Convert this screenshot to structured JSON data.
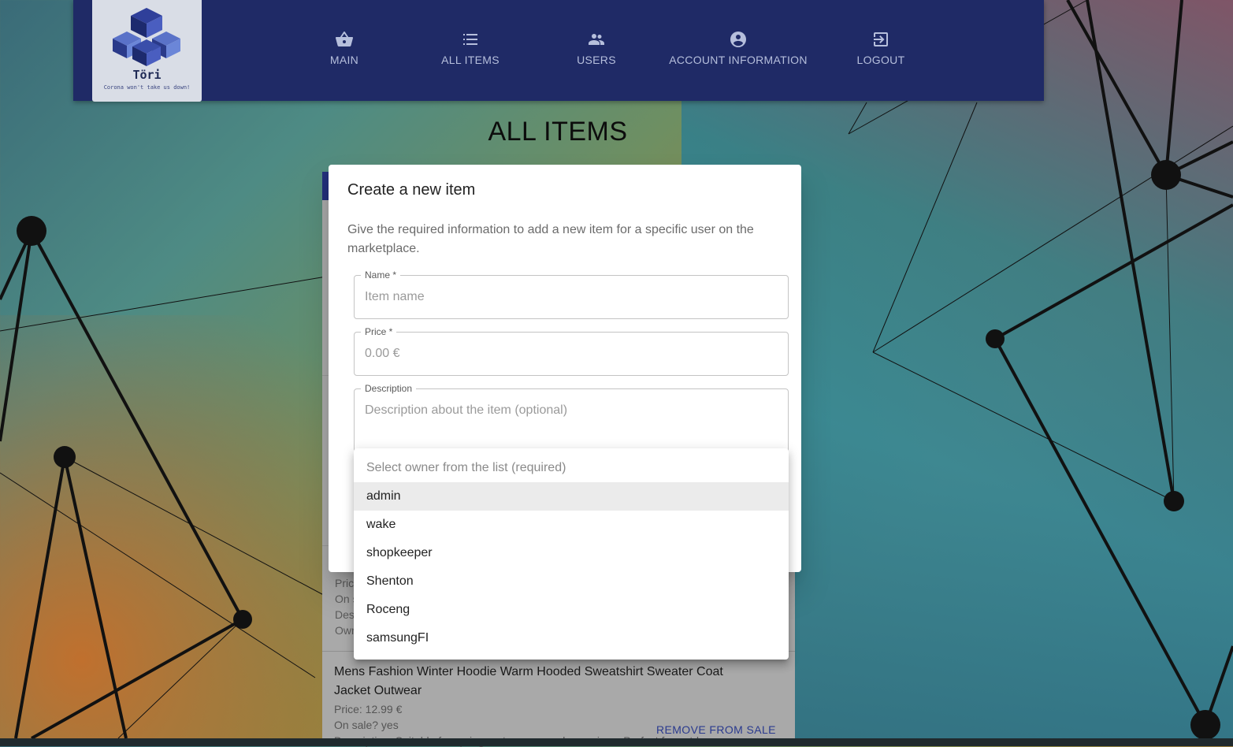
{
  "nav": {
    "logo_title": "Töri",
    "logo_tagline": "Corona won't take us down!",
    "items": [
      {
        "label": "MAIN",
        "icon": "basket-icon"
      },
      {
        "label": "ALL ITEMS",
        "icon": "list-icon"
      },
      {
        "label": "USERS",
        "icon": "people-icon"
      },
      {
        "label": "ACCOUNT INFORMATION",
        "icon": "account-circle-icon"
      },
      {
        "label": "LOGOUT",
        "icon": "logout-icon"
      }
    ]
  },
  "page": {
    "title": "ALL ITEMS"
  },
  "background_list": {
    "partial_lines": [
      "Pric",
      "On s",
      "Des",
      "Owr"
    ],
    "item": {
      "title": "Mens Fashion Winter Hoodie Warm Hooded Sweatshirt Sweater Coat Jacket Outwear",
      "price": "Price: 12.99 €",
      "on_sale": "On sale? yes",
      "description": "Description: Suitable for spring, autumn, casual occasions. Perfect for outdoor",
      "action": "REMOVE FROM SALE"
    }
  },
  "dialog": {
    "title": "Create a new item",
    "text": "Give the required information to add a new item for a specific user on the marketplace.",
    "fields": {
      "name": {
        "label": "Name *",
        "placeholder": "Item name"
      },
      "price": {
        "label": "Price *",
        "placeholder": "0.00 €"
      },
      "description": {
        "label": "Description",
        "placeholder": "Description about the item (optional)"
      }
    },
    "owner_menu": {
      "placeholder": "Select owner from the list (required)",
      "options": [
        "admin",
        "wake",
        "shopkeeper",
        "Shenton",
        "Roceng",
        "samsungFI"
      ],
      "highlighted": "admin"
    }
  },
  "colors": {
    "navbar": "#1f2a66",
    "nav_text": "#b6bfdc",
    "accent": "#2a3a8e"
  }
}
